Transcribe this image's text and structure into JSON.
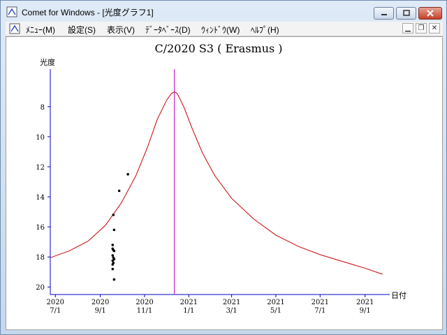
{
  "window": {
    "title": "Comet for Windows - [光度グラフ1]"
  },
  "menu": {
    "items": [
      {
        "label": "ﾒﾆｭｰ(M)"
      },
      {
        "label": "設定(S)"
      },
      {
        "label": "表示(V)"
      },
      {
        "label": "ﾃﾞｰﾀﾍﾞｰｽ(D)"
      },
      {
        "label": "ｳｨﾝﾄﾞｳ(W)"
      },
      {
        "label": "ﾍﾙﾌﾟ(H)"
      }
    ]
  },
  "chart_data": {
    "type": "line",
    "title": "C/2020 S3 ( Erasmus )",
    "ylabel": "光度",
    "xlabel": "日付",
    "y_inverted": true,
    "y_ticks": [
      8,
      10,
      12,
      14,
      16,
      18,
      20
    ],
    "ylim": [
      20.5,
      5.5
    ],
    "xlim": [
      "2020-06-24",
      "2021-10-05"
    ],
    "x_ticks": [
      {
        "date": "2020-07-01",
        "year": "2020",
        "md": "7/1"
      },
      {
        "date": "2020-09-01",
        "year": "2020",
        "md": "9/1"
      },
      {
        "date": "2020-11-01",
        "year": "2020",
        "md": "11/1"
      },
      {
        "date": "2021-01-01",
        "year": "2021",
        "md": "1/1"
      },
      {
        "date": "2021-03-01",
        "year": "2021",
        "md": "3/1"
      },
      {
        "date": "2021-05-01",
        "year": "2021",
        "md": "5/1"
      },
      {
        "date": "2021-07-01",
        "year": "2021",
        "md": "7/1"
      },
      {
        "date": "2021-09-01",
        "year": "2021",
        "md": "9/1"
      }
    ],
    "perihelion_date": "2020-12-12",
    "predicted": {
      "color": "#cc0000",
      "points": [
        [
          "2020-06-24",
          18.05
        ],
        [
          "2020-07-20",
          17.6
        ],
        [
          "2020-08-15",
          16.95
        ],
        [
          "2020-09-08",
          15.9
        ],
        [
          "2020-09-30",
          14.4
        ],
        [
          "2020-10-20",
          12.6
        ],
        [
          "2020-11-05",
          10.7
        ],
        [
          "2020-11-18",
          8.9
        ],
        [
          "2020-12-01",
          7.6
        ],
        [
          "2020-12-08",
          7.12
        ],
        [
          "2020-12-12",
          7.02
        ],
        [
          "2020-12-16",
          7.12
        ],
        [
          "2020-12-25",
          8.0
        ],
        [
          "2021-01-06",
          9.5
        ],
        [
          "2021-01-20",
          11.1
        ],
        [
          "2021-02-06",
          12.6
        ],
        [
          "2021-03-01",
          14.1
        ],
        [
          "2021-04-01",
          15.5
        ],
        [
          "2021-05-01",
          16.55
        ],
        [
          "2021-06-01",
          17.3
        ],
        [
          "2021-07-01",
          17.85
        ],
        [
          "2021-08-01",
          18.3
        ],
        [
          "2021-09-01",
          18.75
        ],
        [
          "2021-09-25",
          19.15
        ]
      ]
    },
    "observed": {
      "color": "#000000",
      "points": [
        [
          "2020-10-09",
          12.5
        ],
        [
          "2020-09-27",
          13.6
        ],
        [
          "2020-09-19",
          15.2
        ],
        [
          "2020-09-20",
          16.2
        ],
        [
          "2020-09-18",
          17.2
        ],
        [
          "2020-09-18",
          17.45
        ],
        [
          "2020-09-19",
          17.55
        ],
        [
          "2020-09-20",
          17.6
        ],
        [
          "2020-09-18",
          17.9
        ],
        [
          "2020-09-19",
          18.05
        ],
        [
          "2020-09-20",
          18.15
        ],
        [
          "2020-09-18",
          18.25
        ],
        [
          "2020-09-19",
          18.4
        ],
        [
          "2020-09-18",
          18.5
        ],
        [
          "2020-09-18",
          18.8
        ],
        [
          "2020-09-20",
          19.5
        ]
      ]
    }
  }
}
